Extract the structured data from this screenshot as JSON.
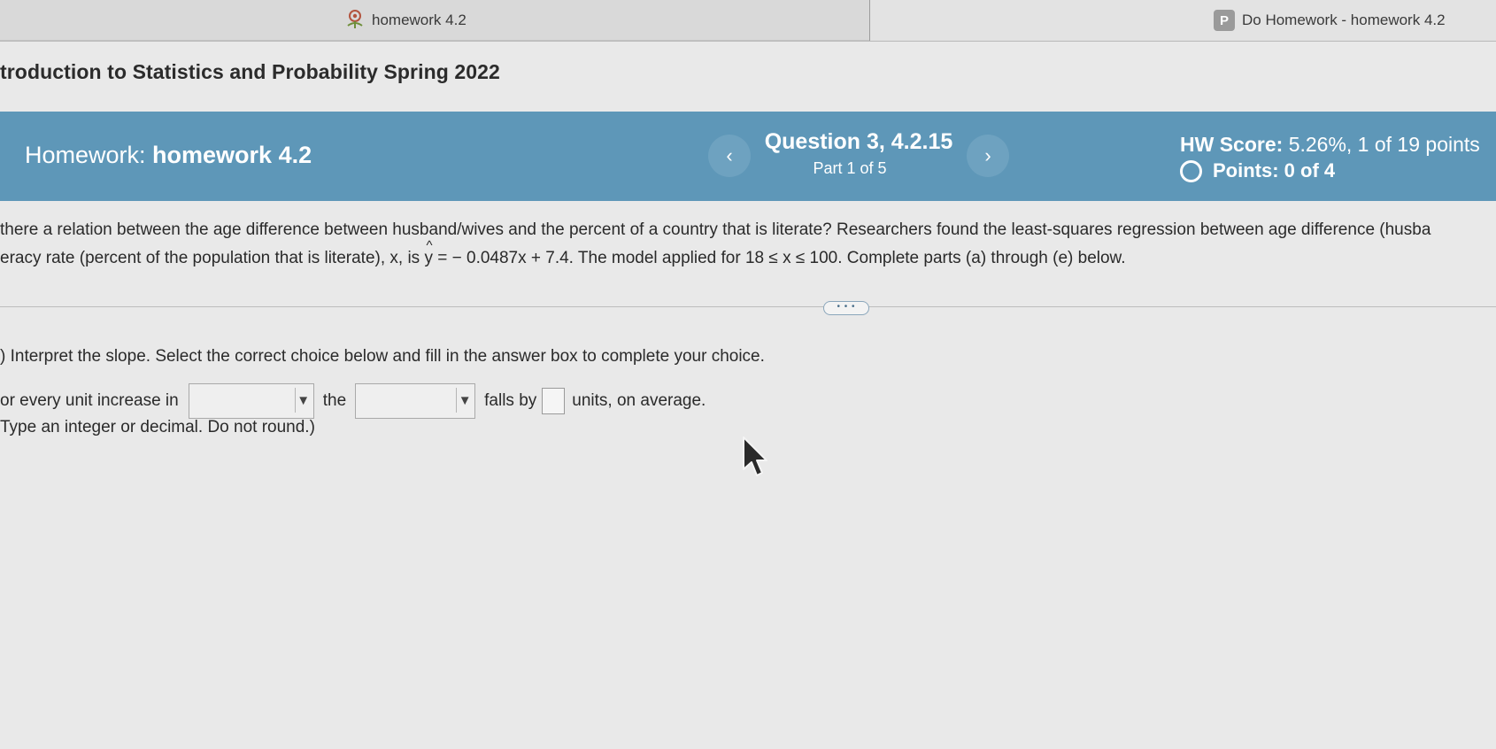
{
  "browser": {
    "tabs": [
      {
        "label": "homework 4.2",
        "icon": "flower-favicon-icon"
      },
      {
        "label": "Do Homework - homework 4.2",
        "icon": "pearson-p-favicon-icon",
        "favicon_letter": "P"
      }
    ]
  },
  "course": {
    "title": "troduction to Statistics and Probability Spring 2022"
  },
  "header": {
    "homework_prefix": "Homework:",
    "homework_name": "homework 4.2",
    "question_title": "Question 3, 4.2.15",
    "question_part": "Part 1 of 5",
    "prev_label": "‹",
    "next_label": "›",
    "hw_score_label": "HW Score:",
    "hw_score_value": "5.26%, 1 of 19 points",
    "points_label": "Points: 0 of 4",
    "bar_color": "#5e97b8"
  },
  "question": {
    "line1": "there a relation between the age difference between husband/wives and the percent of a country that is literate? Researchers found the least-squares regression between age difference (husba",
    "line2_before": "eracy rate (percent of the population that is literate), x, is ",
    "line2_yhat": "y",
    "line2_after": " = − 0.0487x + 7.4. The model applied for 18 ≤ x ≤ 100. Complete parts (a) through (e) below."
  },
  "expand_label": "• • •",
  "part_a": {
    "prompt": ") Interpret the slope. Select the correct choice below and fill in the answer box to complete your choice.",
    "text1": "or every unit increase in",
    "select1_value": "",
    "text2": "the",
    "select2_value": "",
    "text3": "falls by",
    "answer_value": "",
    "text4": "units, on average.",
    "hint": "Type an integer or decimal. Do not round.)"
  },
  "select_arrow": "▼"
}
